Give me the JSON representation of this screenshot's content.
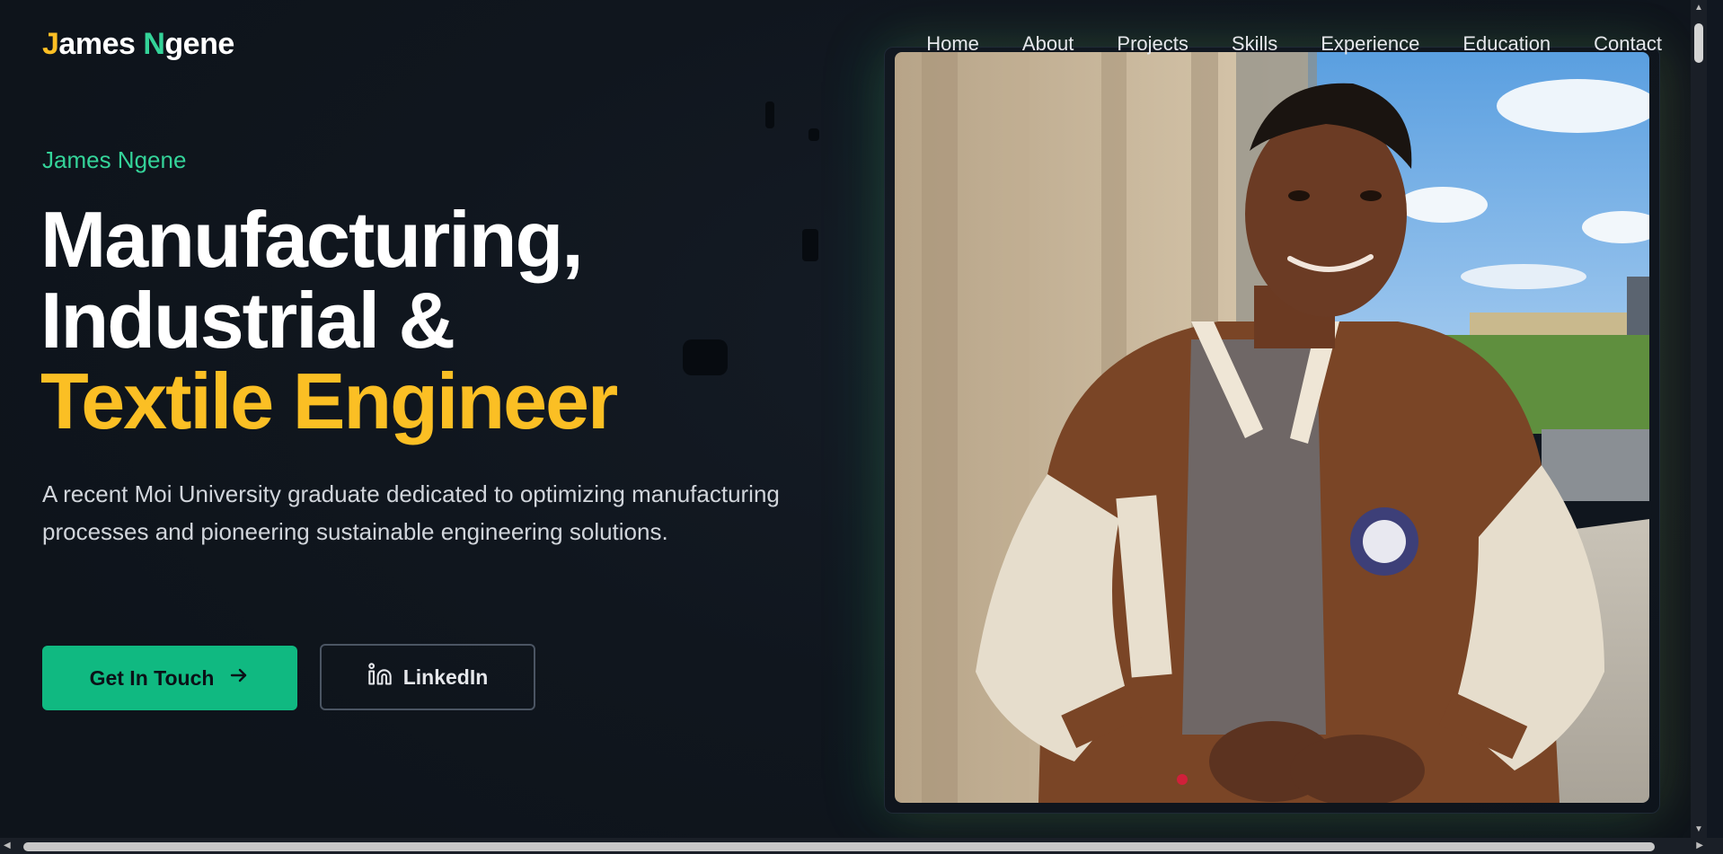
{
  "brand": {
    "logo_part1": "J",
    "logo_part2": "ames ",
    "logo_part3": "N",
    "logo_part4": "gene"
  },
  "nav": {
    "items": [
      "Home",
      "About",
      "Projects",
      "Skills",
      "Experience",
      "Education",
      "Contact"
    ]
  },
  "hero": {
    "eyebrow": "James Ngene",
    "headline_line1": "Manufacturing,",
    "headline_line2": "Industrial &",
    "headline_line3": "Textile Engineer",
    "description": "A recent Moi University graduate dedicated to optimizing manufacturing processes and pioneering sustainable engineering solutions.",
    "primary_button": "Get In Touch",
    "secondary_button": "LinkedIn"
  },
  "colors": {
    "background": "#111720",
    "accent_green": "#10b981",
    "accent_yellow": "#fbbf24",
    "text_primary": "#ffffff",
    "text_secondary": "#d1d5db"
  },
  "icons": {
    "primary_button_icon": "arrow-right-icon",
    "secondary_button_icon": "linkedin-icon"
  }
}
